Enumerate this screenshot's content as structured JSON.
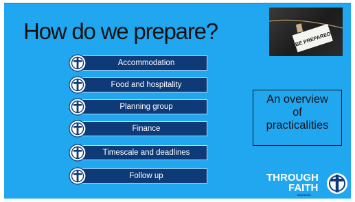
{
  "slide": {
    "title": "How do we prepare?",
    "items": [
      {
        "label": "Accommodation"
      },
      {
        "label": "Food and hospitality"
      },
      {
        "label": "Planning group"
      },
      {
        "label": "Finance"
      },
      {
        "label": "Timescale and deadlines"
      },
      {
        "label": "Follow up"
      }
    ],
    "photo_text": "BE PREPARED",
    "overview": {
      "line1": "An overview",
      "line2": "of",
      "line3": "practicalities"
    },
    "logo": {
      "line1": "THROUGH",
      "line2": "FAITH",
      "line3": "MISSIONS"
    }
  },
  "colors": {
    "background": "#21a7f0",
    "pill": "#0e3b78",
    "text_dark": "#111111"
  },
  "icons": [
    "tfm-badge-icon"
  ]
}
